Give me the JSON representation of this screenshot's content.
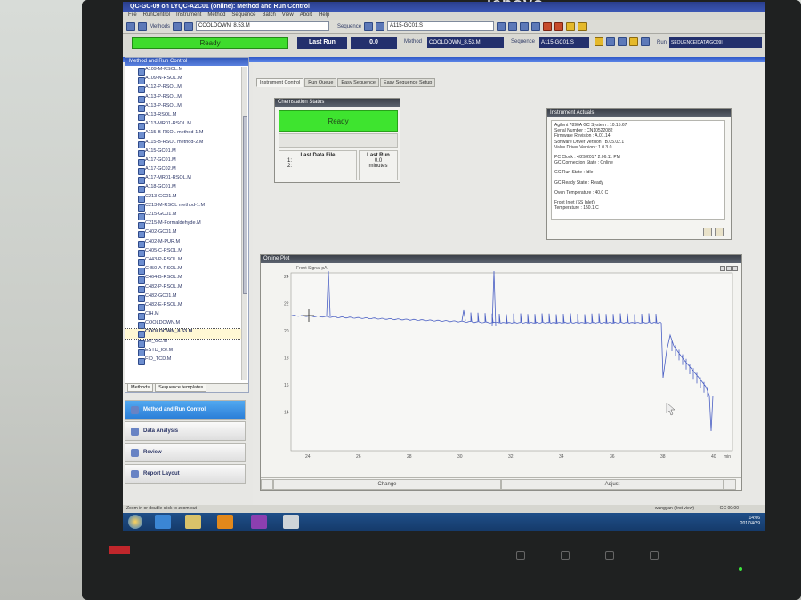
{
  "monitor": {
    "brand": "lenovo"
  },
  "window": {
    "title": "QC-GC-09 on LYQC-A2C01 (online): Method and Run Control"
  },
  "menu": [
    "File",
    "RunControl",
    "Instrument",
    "Method",
    "Sequence",
    "Batch",
    "View",
    "Abort",
    "Help"
  ],
  "toolbar": {
    "methods_label": "Methods",
    "method_combo": "COOLDOWN_8.53.M",
    "sequence_label": "Sequence",
    "sequence_combo": "A115-GC01.S"
  },
  "status": {
    "ready_label": "Ready",
    "last_run_label": "Last Run",
    "last_run_value": "0.0",
    "method_label": "Method",
    "method_value": "COOLDOWN_8.53.M",
    "sequence_label": "Sequence",
    "sequence_value": "A115-GC01.S",
    "run_label": "Run",
    "run_value": "SEQUENCE|DATA|GC09|"
  },
  "left_pane": {
    "title": "Method and Run Control",
    "items": [
      "A109-M-RSOL.M",
      "A109-N-RSOL.M",
      "A112-P-RSOL.M",
      "A113-P-RSOL.M",
      "A113-P-RSOL.M",
      "A113-RSOL.M",
      "A113-MR01-RSOL.M",
      "A115-B-RSOL method-1.M",
      "A115-B-RSOL method-2.M",
      "A115-GC01.M",
      "A117-GC01.M",
      "A117-GC02.M",
      "A117-MR01-RSOL.M",
      "A118-GC01.M",
      "C213-GC01.M",
      "C213-M-RSOL method-1.M",
      "C215-GC01.M",
      "C215-M-Formaldehyde.M",
      "C402-GC01.M",
      "C402-M-PUR.M",
      "C405-C-RSOL.M",
      "C443-P-RSOL.M",
      "C450-A-RSOL.M",
      "C464-B-RSOL.M",
      "C482-P-RSOL.M",
      "C482-GC01.M",
      "C482-E-RSOL.M",
      "CIH.M",
      "COOLDOWN.M",
      "COOLDOWN_8.53.M",
      "def_GC.M",
      "ESTD_Ice.M",
      "FID_TCD.M"
    ],
    "selected_index": 29,
    "tabs": [
      "Methods",
      "Sequence templates"
    ]
  },
  "nav": [
    {
      "label": "Method and Run Control",
      "active": true
    },
    {
      "label": "Data Analysis",
      "active": false
    },
    {
      "label": "Review",
      "active": false
    },
    {
      "label": "Report Layout",
      "active": false
    }
  ],
  "tabs": [
    "Instrument Control",
    "Run Queue",
    "Easy Sequence",
    "Easy Sequence Setup"
  ],
  "chem_status": {
    "title": "Chemstation Status",
    "state": "Ready",
    "last_data_file_label": "Last Data File",
    "file_line_1": "1:",
    "file_line_2": "2:",
    "last_run_label": "Last Run",
    "last_run_value": "0.0",
    "last_run_unit": "minutes"
  },
  "instrument": {
    "title": "Instrument Actuals",
    "lines": [
      "Agilent 7890A GC System : 10.15.67",
      "Serial Number : CN10522082",
      "Firmware Revision : A.01.14",
      "Software Driver Version : B.05.02.1",
      "Valve Driver Version : 1.0.3.0",
      "",
      "PC Clock : 4/29/2017 2:06:11 PM",
      "GC Connection State : Online",
      "",
      "GC Run State : Idle",
      "",
      "GC Ready State : Ready",
      "",
      "Oven Temperature : 40.0 C",
      "",
      "Front Inlet (SS Inlet)",
      "  Temperature : 150.1 C"
    ]
  },
  "plot": {
    "title": "Online Plot",
    "subtitle": "Front Signal pA",
    "change_label": "Change",
    "adjust_label": "Adjust",
    "y_ticks": [
      "24",
      "22",
      "20",
      "18",
      "16",
      "14"
    ],
    "x_ticks": [
      "24",
      "26",
      "28",
      "30",
      "32",
      "34",
      "36",
      "38",
      "40"
    ],
    "x_extra_tick": "min"
  },
  "statusbar": {
    "hint": "Zoom in or double click to zoom out",
    "user": "wangyan (first view)",
    "gc": "GC 00:00"
  },
  "taskbar": {
    "time": "14:06",
    "date": "2017/4/29"
  },
  "colors": {
    "ready_green": "#3fdc2d",
    "header_navy": "#23306d",
    "accent_blue": "#2b7fd8",
    "trace": "#4a5fc4"
  }
}
